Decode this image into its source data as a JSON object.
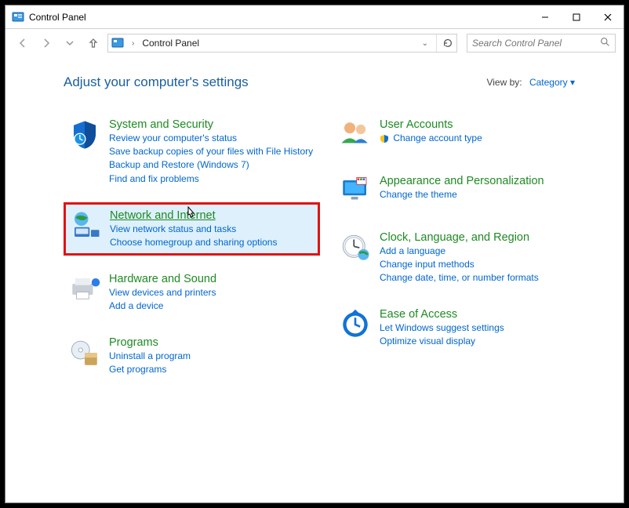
{
  "window_title": "Control Panel",
  "nav": {
    "breadcrumb": "Control Panel",
    "search_placeholder": "Search Control Panel"
  },
  "header": {
    "adjust": "Adjust your computer's settings",
    "viewby_label": "View by:",
    "viewby_value": "Category"
  },
  "left": [
    {
      "title": "System and Security",
      "links": [
        "Review your computer's status",
        "Save backup copies of your files with File History",
        "Backup and Restore (Windows 7)",
        "Find and fix problems"
      ]
    },
    {
      "title": "Network and Internet",
      "links": [
        "View network status and tasks",
        "Choose homegroup and sharing options"
      ]
    },
    {
      "title": "Hardware and Sound",
      "links": [
        "View devices and printers",
        "Add a device"
      ]
    },
    {
      "title": "Programs",
      "links": [
        "Uninstall a program",
        "Get programs"
      ]
    }
  ],
  "right": [
    {
      "title": "User Accounts",
      "links": [
        "Change account type"
      ],
      "shield": true
    },
    {
      "title": "Appearance and Personalization",
      "links": [
        "Change the theme"
      ]
    },
    {
      "title": "Clock, Language, and Region",
      "links": [
        "Add a language",
        "Change input methods",
        "Change date, time, or number formats"
      ]
    },
    {
      "title": "Ease of Access",
      "links": [
        "Let Windows suggest settings",
        "Optimize visual display"
      ]
    }
  ]
}
